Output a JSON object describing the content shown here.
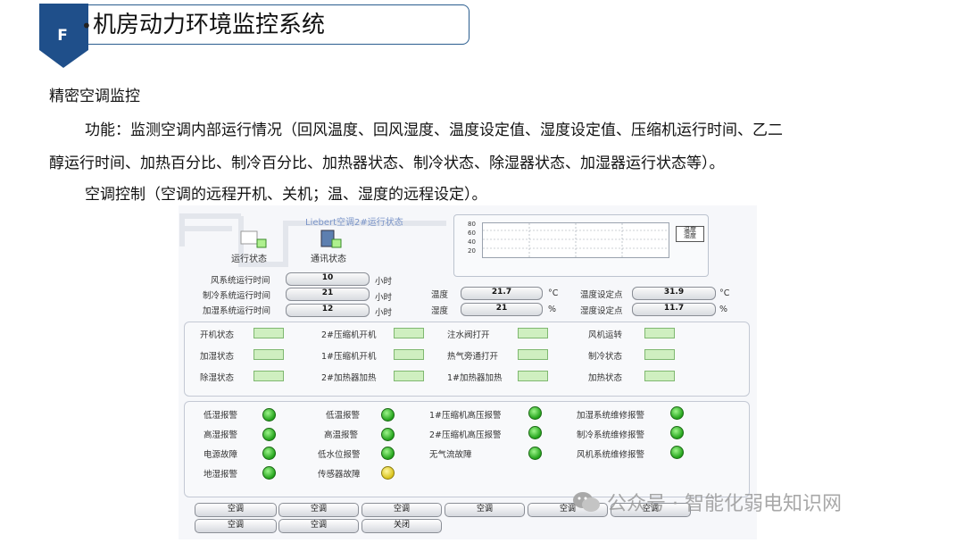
{
  "header": {
    "badge_letter": "F",
    "title": "机房动力环境监控系统",
    "accent_color": "#1f4f8a"
  },
  "content": {
    "section_heading": "精密空调监控",
    "function_line1": "功能：监测空调内部运行情况（回风温度、回风湿度、温度设定值、湿度设定值、压缩机运行时间、乙二",
    "function_line2": "醇运行时间、加热百分比、制冷百分比、加热器状态、制冷状态、除湿器状态、加湿器运行状态等）。",
    "control_line": "空调控制（空调的远程开机、关机；温、湿度的远程设定）。"
  },
  "panel": {
    "title": "Liebert空调2#运行状态",
    "icons": [
      {
        "label": "运行状态",
        "icon": "running-status-icon"
      },
      {
        "label": "通讯状态",
        "icon": "communication-status-icon"
      }
    ],
    "chart": {
      "y_ticks": [
        "80",
        "60",
        "40",
        "20"
      ],
      "legend_label_1": "温度",
      "legend_label_2": "湿度"
    },
    "runtime": [
      {
        "label": "风系统运行时间",
        "value": "10",
        "unit": "小时"
      },
      {
        "label": "制冷系统运行时间",
        "value": "21",
        "unit": "小时"
      },
      {
        "label": "加湿系统运行时间",
        "value": "12",
        "unit": "小时"
      }
    ],
    "readings": [
      {
        "label": "温度",
        "value": "21.7",
        "unit": "°C"
      },
      {
        "label": "湿度",
        "value": "21",
        "unit": "%"
      }
    ],
    "setpoints": [
      {
        "label": "温度设定点",
        "value": "31.9",
        "unit": "°C"
      },
      {
        "label": "湿度设定点",
        "value": "11.7",
        "unit": "%"
      }
    ],
    "states": [
      [
        "开机状态",
        "2#压缩机开机",
        "注水阀打开",
        "风机运转"
      ],
      [
        "加湿状态",
        "1#压缩机开机",
        "热气旁通打开",
        "制冷状态"
      ],
      [
        "除湿状态",
        "2#加热器加热",
        "1#加热器加热",
        "加热状态"
      ]
    ],
    "alarms": [
      [
        "低湿报警",
        "低温报警",
        "1#压缩机高压报警",
        "加湿系统维修报警"
      ],
      [
        "高湿报警",
        "高温报警",
        "2#压缩机高压报警",
        "制冷系统维修报警"
      ],
      [
        "电源故障",
        "低水位报警",
        "无气流故障",
        "风机系统维修报警"
      ],
      [
        "地湿报警",
        "传感器故障"
      ]
    ],
    "alarm_colors": {
      "ok": "#22a21a",
      "warn": "#d9c21a"
    },
    "buttons_row1": [
      "空调",
      "空调",
      "空调",
      "空调",
      "空调",
      "空调"
    ],
    "buttons_row2": [
      "空调",
      "空调",
      "关闭"
    ]
  },
  "watermark": "公众号 · 智能化弱电知识网"
}
